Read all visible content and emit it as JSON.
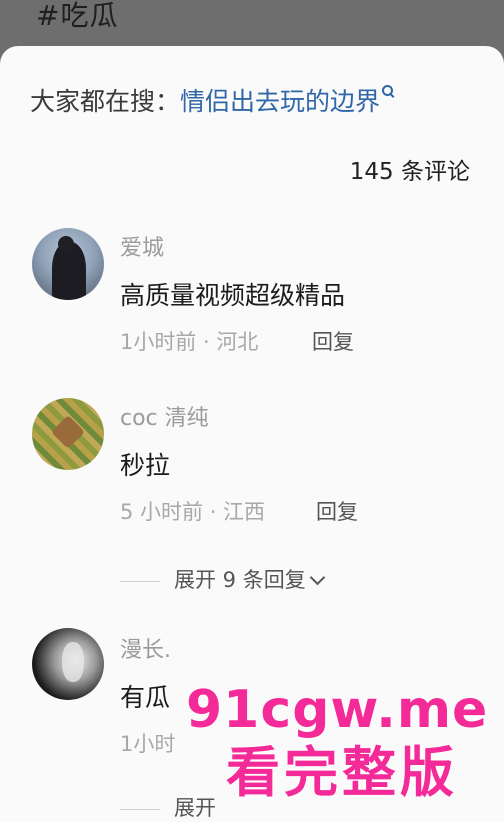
{
  "header": {
    "hashtag": "#吃瓜"
  },
  "search_hint": {
    "prefix": "大家都在搜：",
    "query": "情侣出去玩的边界",
    "icon": "search-icon"
  },
  "comment_count": "145 条评论",
  "comments": [
    {
      "username": "爱城",
      "text": "高质量视频超级精品",
      "meta": "1小时前 · 河北",
      "reply": "回复"
    },
    {
      "username": "coc 清纯",
      "text": "秒拉",
      "meta": "5 小时前 · 江西",
      "reply": "回复",
      "expand": "展开 9 条回复"
    },
    {
      "username": "漫长.",
      "text": "有瓜",
      "meta": "1小时",
      "reply": "",
      "expand": "展开"
    }
  ],
  "watermark": {
    "line1": "91cgw.me",
    "line2": "看完整版",
    "color": "#f32a97"
  }
}
